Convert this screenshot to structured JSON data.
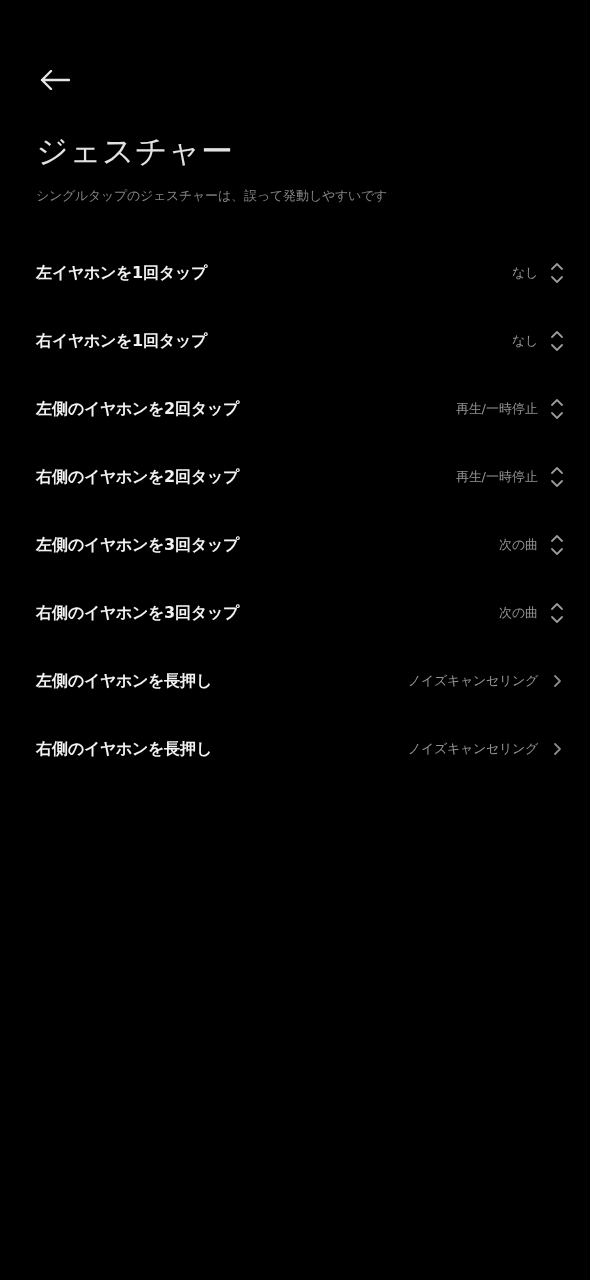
{
  "title": "ジェスチャー",
  "subtitle": "シングルタップのジェスチャーは、誤って発動しやすいです",
  "rows": [
    {
      "label": "左イヤホンを1回タップ",
      "value": "なし",
      "kind": "picker"
    },
    {
      "label": "右イヤホンを1回タップ",
      "value": "なし",
      "kind": "picker"
    },
    {
      "label": "左側のイヤホンを2回タップ",
      "value": "再生/一時停止",
      "kind": "picker"
    },
    {
      "label": "右側のイヤホンを2回タップ",
      "value": "再生/一時停止",
      "kind": "picker"
    },
    {
      "label": "左側のイヤホンを3回タップ",
      "value": "次の曲",
      "kind": "picker"
    },
    {
      "label": "右側のイヤホンを3回タップ",
      "value": "次の曲",
      "kind": "picker"
    },
    {
      "label": "左側のイヤホンを長押し",
      "value": "ノイズキャンセリング",
      "kind": "link"
    },
    {
      "label": "右側のイヤホンを長押し",
      "value": "ノイズキャンセリング",
      "kind": "link"
    }
  ]
}
